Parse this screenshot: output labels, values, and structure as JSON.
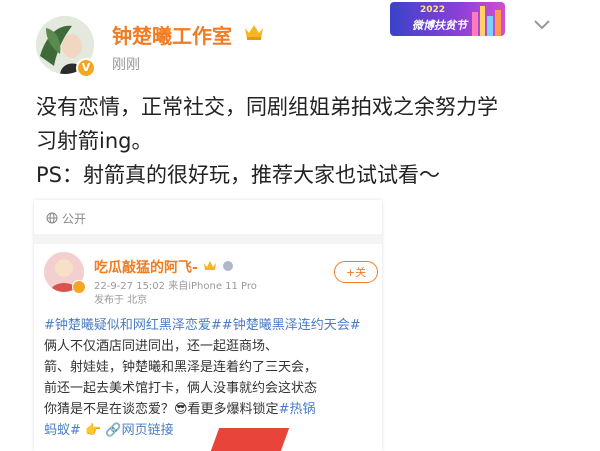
{
  "post": {
    "author_name": "钟楚曦工作室",
    "timestamp": "刚刚",
    "content_line1": "没有恋情，正常社交，同剧组姐弟拍戏之余努力学",
    "content_line2": "习射箭ing。",
    "content_line3": "PS：射箭真的很好玩，推荐大家也试试看～"
  },
  "promo_badge": {
    "year": "2022",
    "text": "微博扶贫节"
  },
  "embedded_post": {
    "visibility": "公开",
    "author_name": "吃瓜敲猛的阿飞-",
    "meta_time": "22-9-27 15:02",
    "meta_device": "来自iPhone 11 Pro",
    "meta_location": "发布于 北京",
    "follow_label": "+关",
    "tag1": "#钟楚曦疑似和网红黑泽恋爱#",
    "tag2": "#钟楚曦黑泽连约天会#",
    "body1": "俩人不仅酒店同进同出，还一起逛商场、",
    "body2": "箭、射娃娃，钟楚曦和黑泽是连着约了三天会，",
    "body3": "前还一起去美术馆打卡，俩人没事就约会这状态",
    "body4": "你猜是不是在谈恋爱？😎看更多爆料锁定",
    "tag3": "#热锅",
    "body5": "蚂蚁#",
    "link_label": "网页链接"
  },
  "colors": {
    "name_orange": "#f07c23",
    "topic_blue": "#4a7cc7"
  }
}
